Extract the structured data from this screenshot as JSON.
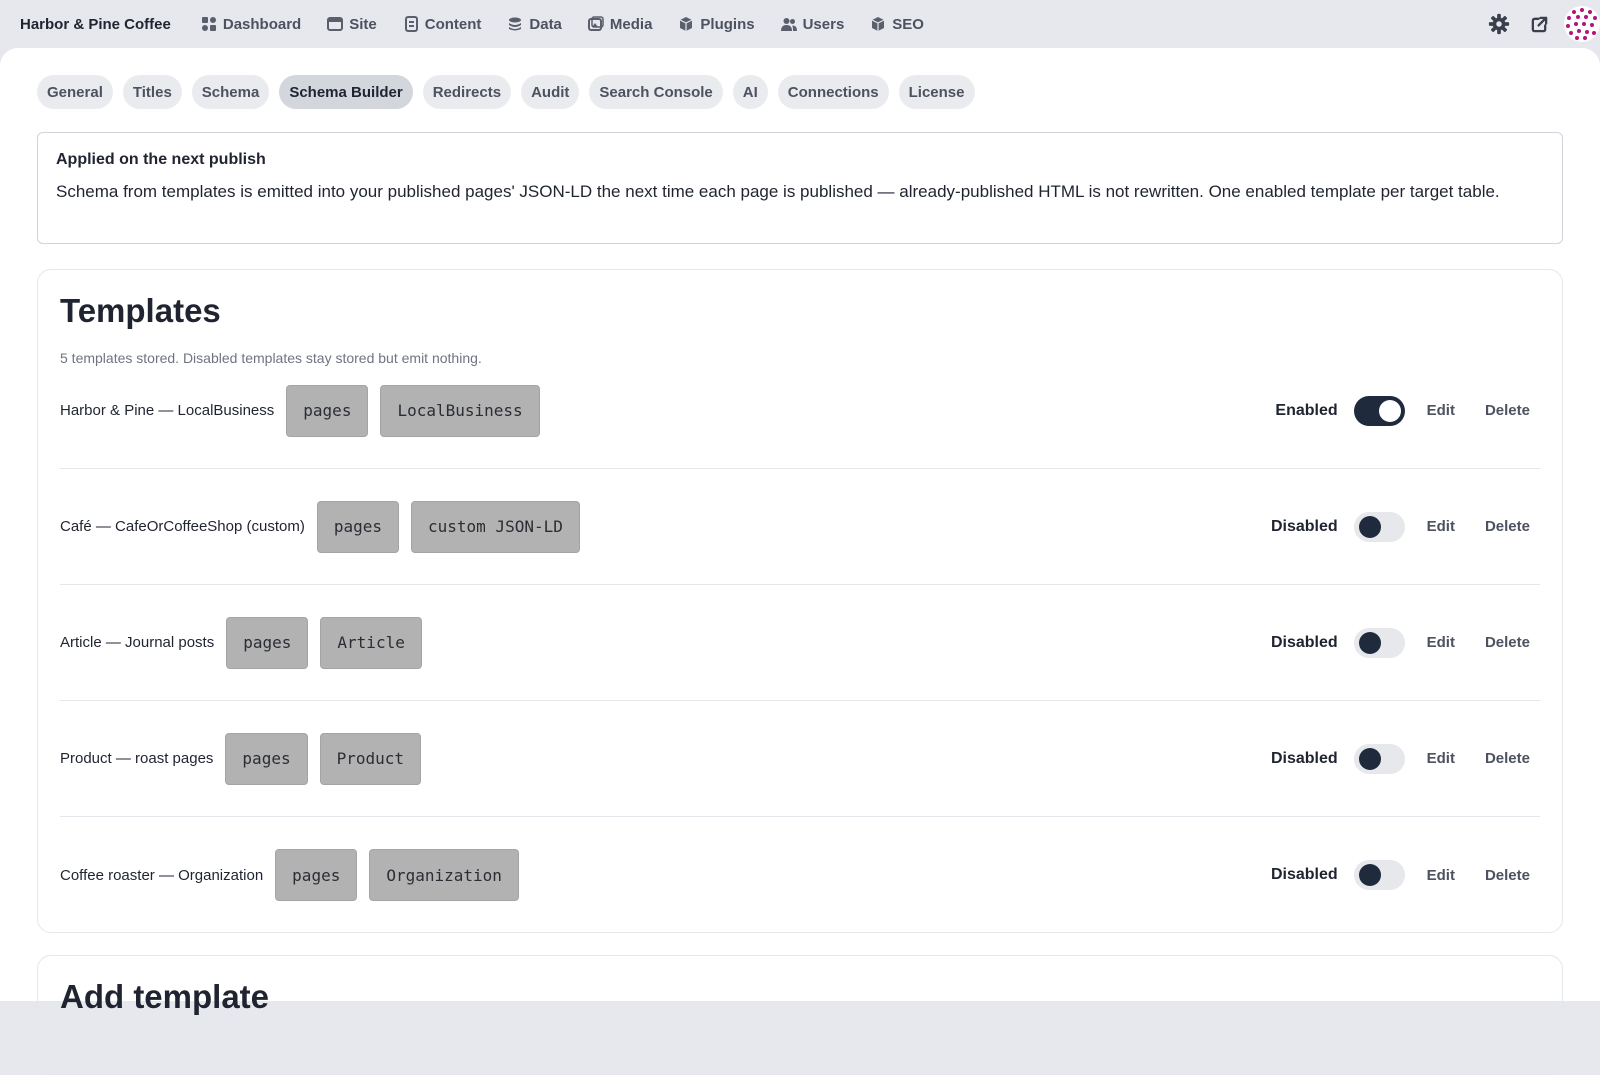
{
  "app": {
    "brand": "Harbor & Pine Coffee",
    "nav": [
      {
        "label": "Dashboard",
        "icon": "dashboard-icon"
      },
      {
        "label": "Site",
        "icon": "site-icon"
      },
      {
        "label": "Content",
        "icon": "content-icon"
      },
      {
        "label": "Data",
        "icon": "database-icon"
      },
      {
        "label": "Media",
        "icon": "media-icon"
      },
      {
        "label": "Plugins",
        "icon": "plugin-icon"
      },
      {
        "label": "Users",
        "icon": "users-icon"
      },
      {
        "label": "SEO",
        "icon": "seo-icon"
      }
    ],
    "top_right_icons": [
      "gear-icon",
      "external-link-icon",
      "avatar"
    ]
  },
  "tabs": [
    "General",
    "Titles",
    "Schema",
    "Schema Builder",
    "Redirects",
    "Audit",
    "Search Console",
    "AI",
    "Connections",
    "License"
  ],
  "active_tab": "Schema Builder",
  "notice": {
    "title": "Applied on the next publish",
    "body": "Schema from templates is emitted into your published pages' JSON-LD the next time each page is published — already-published HTML is not rewritten. One enabled template per target table."
  },
  "templates": {
    "title": "Templates",
    "subtitle": "5 templates stored. Disabled templates stay stored but emit nothing.",
    "rows": [
      {
        "name": "Harbor & Pine — LocalBusiness",
        "table": "pages",
        "type": "LocalBusiness",
        "status": "Enabled",
        "enabled": true,
        "edit": "Edit",
        "delete": "Delete"
      },
      {
        "name": "Café — CafeOrCoffeeShop (custom)",
        "table": "pages",
        "type": "custom JSON-LD",
        "status": "Disabled",
        "enabled": false,
        "edit": "Edit",
        "delete": "Delete"
      },
      {
        "name": "Article — Journal posts",
        "table": "pages",
        "type": "Article",
        "status": "Disabled",
        "enabled": false,
        "edit": "Edit",
        "delete": "Delete"
      },
      {
        "name": "Product — roast pages",
        "table": "pages",
        "type": "Product",
        "status": "Disabled",
        "enabled": false,
        "edit": "Edit",
        "delete": "Delete"
      },
      {
        "name": "Coffee roaster — Organization",
        "table": "pages",
        "type": "Organization",
        "status": "Disabled",
        "enabled": false,
        "edit": "Edit",
        "delete": "Delete"
      }
    ]
  },
  "add_template": {
    "title": "Add template"
  },
  "colors": {
    "accent": "#1f2a3c",
    "chip_bg": "#b2b2b2",
    "topbar_bg": "#e6e8ee"
  }
}
